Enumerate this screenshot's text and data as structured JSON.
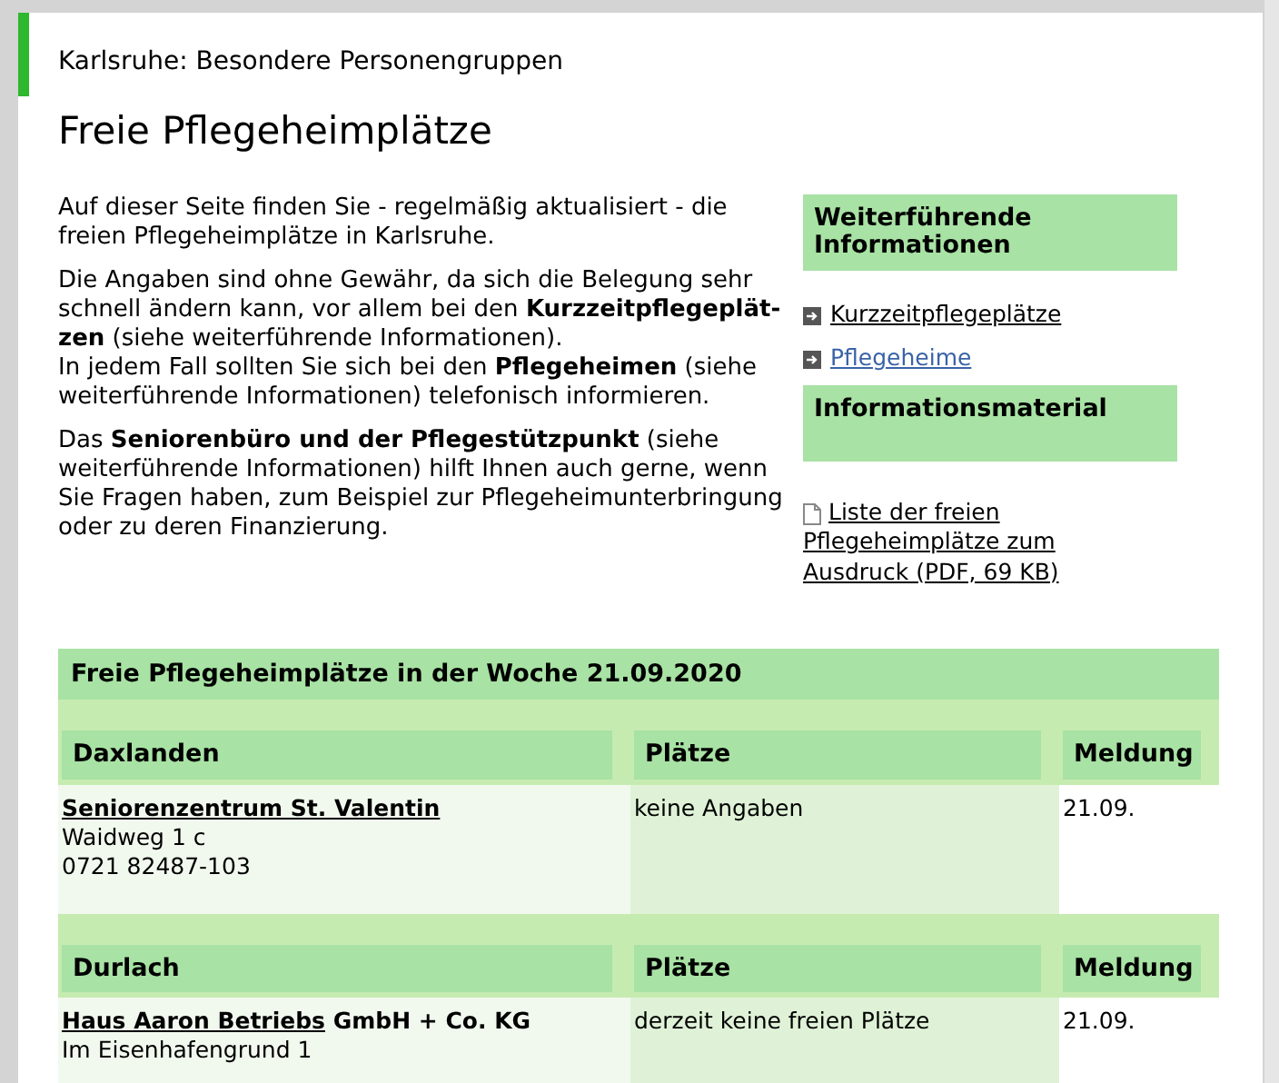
{
  "breadcrumb": "Karlsruhe: Besondere Personengruppen",
  "title": "Freie Pflegeheimplätze",
  "paragraphs": [
    [
      "Auf dieser Seite finden Sie - regelmäßig aktualisiert - die freien Pflegeheimplätze in Karlsruhe."
    ],
    [
      "Die Angaben sind ohne Gewähr, da sich die Belegung sehr schnell ändern kann, vor allem bei den **Kurzzeitpflegeplät-zen** (siehe weiterführende Informationen).",
      "In jedem Fall sollten Sie sich bei den **Pflegeheimen** (siehe weiterführende Informationen) telefonisch informieren."
    ],
    [
      "Das **Seniorenbüro und der Pflegestützpunkt** (siehe weiterführende Informationen) hilft Ihnen auch gerne, wenn Sie Fragen haben, zum Beispiel zur Pflegeheimunterbringung oder zu deren Finanzierung."
    ]
  ],
  "sidebar": [
    {
      "heading": "Weiterführende Informationen",
      "links": [
        {
          "kind": "arrow",
          "label": "Kurzzeitpflegeplätze",
          "visited": false
        },
        {
          "kind": "arrow",
          "label": "Pflegeheime",
          "visited": true
        }
      ]
    },
    {
      "heading": "Informationsmaterial",
      "links": [
        {
          "kind": "document",
          "label": "Liste der freien Pflegeheimplätze zum Ausdruck (PDF, 69 KB)",
          "visited": false
        }
      ]
    }
  ],
  "table": {
    "title": "Freie Pflegeheimplätze in der Woche 21.09.2020",
    "groups": [
      {
        "columns": [
          "Daxlanden",
          "Plätze",
          "Meldung"
        ],
        "rows": [
          {
            "link": "Seniorenzentrum St. Valentin",
            "lines": [
              "Waidweg 1 c",
              "0721 82487-103"
            ],
            "places": "keine Angaben",
            "date": "21.09."
          }
        ]
      },
      {
        "columns": [
          "Durlach",
          "Plätze",
          "Meldung"
        ],
        "rows": [
          {
            "link": "Haus Aaron Betriebs",
            "rest": " GmbH + Co. KG",
            "lines": [
              "Im Eisenhafengrund 1"
            ],
            "places": "derzeit keine freien Plätze",
            "date": "21.09."
          }
        ]
      }
    ]
  }
}
